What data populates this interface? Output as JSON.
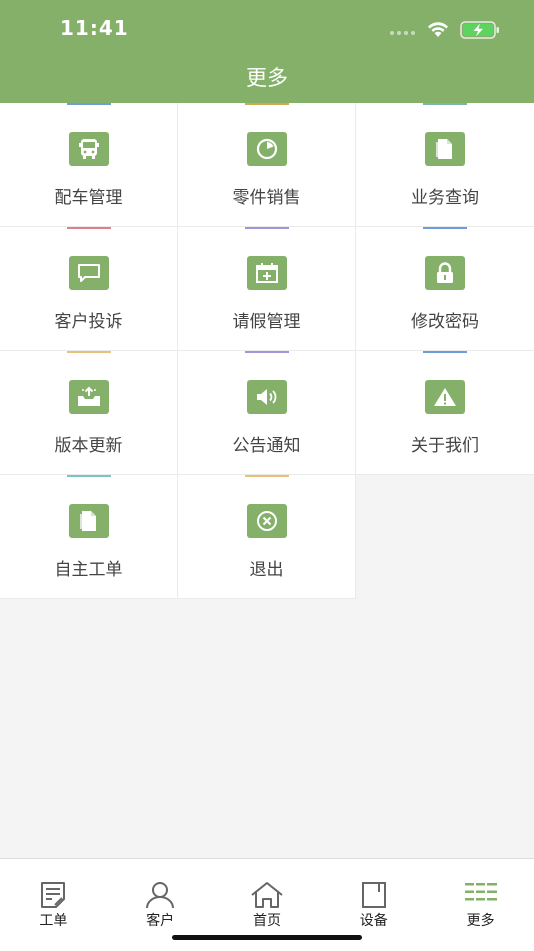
{
  "status": {
    "time": "11:41"
  },
  "header": {
    "title": "更多"
  },
  "grid": {
    "items": [
      {
        "label": "配车管理",
        "accent": "#6f9bd8",
        "icon": "bus-icon"
      },
      {
        "label": "零件销售",
        "accent": "#d2a94e",
        "icon": "pie-chart-icon"
      },
      {
        "label": "业务查询",
        "accent": "#7ab5a5",
        "icon": "document-icon"
      },
      {
        "label": "客户投诉",
        "accent": "#e07f8c",
        "icon": "message-icon"
      },
      {
        "label": "请假管理",
        "accent": "#a595d8",
        "icon": "calendar-add-icon"
      },
      {
        "label": "修改密码",
        "accent": "#6f9bd8",
        "icon": "lock-icon"
      },
      {
        "label": "版本更新",
        "accent": "#e8c07d",
        "icon": "upload-tray-icon"
      },
      {
        "label": "公告通知",
        "accent": "#a595d8",
        "icon": "speaker-icon"
      },
      {
        "label": "关于我们",
        "accent": "#6f9bd8",
        "icon": "warning-icon"
      },
      {
        "label": "自主工单",
        "accent": "#7ac4c9",
        "icon": "document-icon"
      },
      {
        "label": "退出",
        "accent": "#e8c07d",
        "icon": "close-circle-icon"
      }
    ]
  },
  "tabbar": {
    "tabs": [
      {
        "label": "工单",
        "icon": "work-order-icon"
      },
      {
        "label": "客户",
        "icon": "person-icon"
      },
      {
        "label": "首页",
        "icon": "home-icon"
      },
      {
        "label": "设备",
        "icon": "device-book-icon"
      },
      {
        "label": "更多",
        "icon": "more-list-icon",
        "active": true
      }
    ],
    "active_color": "#84b06a"
  }
}
